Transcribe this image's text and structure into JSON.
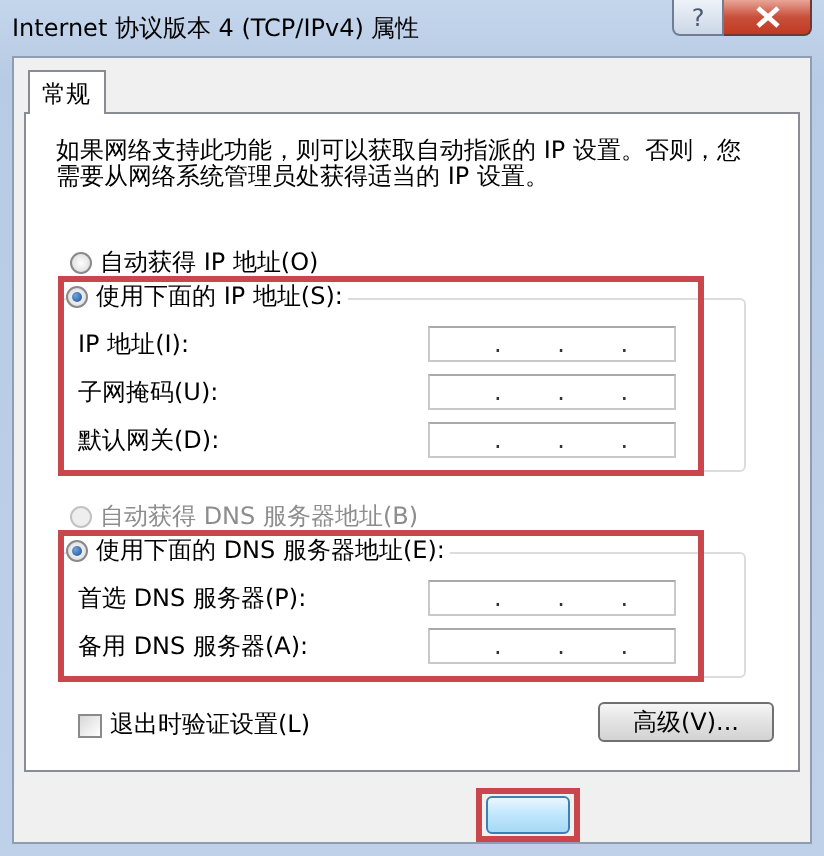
{
  "window": {
    "title": "Internet 协议版本 4 (TCP/IPv4) 属性",
    "help_button": "?"
  },
  "tabs": [
    {
      "label": "常规",
      "selected": true
    }
  ],
  "description": "如果网络支持此功能，则可以获取自动指派的 IP 设置。否则，您需要从网络系统管理员处获得适当的 IP 设置。",
  "sections": [
    {
      "highlighted": true,
      "options": [
        {
          "label": "自动获得 IP 地址(O)",
          "selected": false,
          "disabled": false
        },
        {
          "label": "使用下面的 IP 地址(S):",
          "selected": true,
          "disabled": false
        }
      ],
      "fields": [
        {
          "label": "IP 地址(I):",
          "value": ". . ."
        },
        {
          "label": "子网掩码(U):",
          "value": ". . ."
        },
        {
          "label": "默认网关(D):",
          "value": ". . ."
        }
      ]
    },
    {
      "highlighted": true,
      "options": [
        {
          "label": "自动获得 DNS 服务器地址(B)",
          "selected": false,
          "disabled": true
        },
        {
          "label": "使用下面的 DNS 服务器地址(E):",
          "selected": true,
          "disabled": false
        }
      ],
      "fields": [
        {
          "label": "首选 DNS 服务器(P):",
          "value": ". . ."
        },
        {
          "label": "备用 DNS 服务器(A):",
          "value": ". . ."
        }
      ]
    }
  ],
  "verify_on_exit": {
    "label": "退出时验证设置(L)",
    "checked": false
  },
  "advanced_button": "高级(V)...",
  "ok_button": {
    "highlighted": true
  }
}
